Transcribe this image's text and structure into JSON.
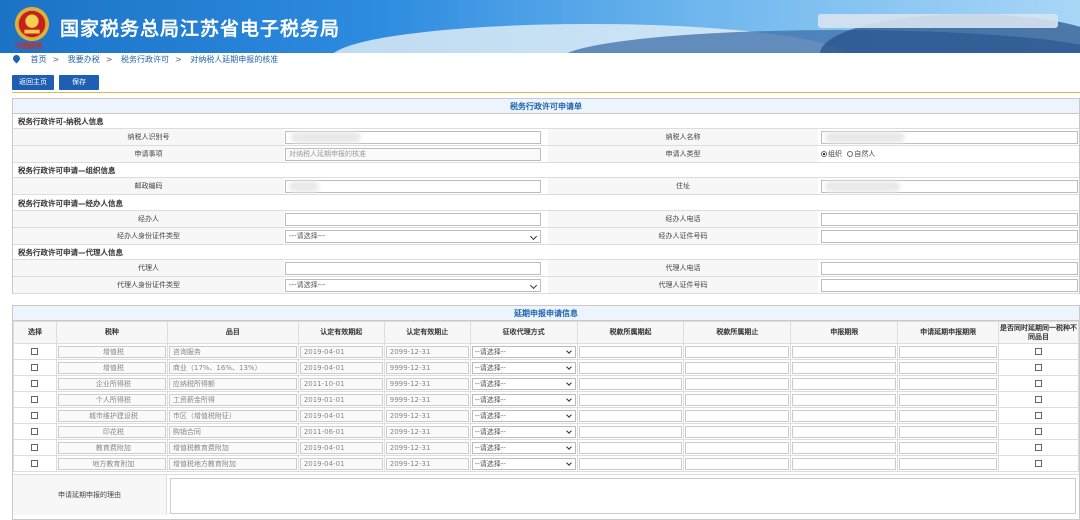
{
  "header": {
    "emblem_name": "tax-emblem",
    "emblem_caption": "中国税务",
    "site_title": "国家税务总局江苏省电子税务局"
  },
  "breadcrumb": [
    "首页",
    "我要办税",
    "税务行政许可",
    "对纳税人延期申报的核准"
  ],
  "toolbar": {
    "back_label": "返回主页",
    "save_label": "保存"
  },
  "form": {
    "title": "税务行政许可申请单",
    "sec_taxpayer": "税务行政许可-纳税人信息",
    "taxpayer_id_label": "纳税人识别号",
    "taxpayer_name_label": "纳税人名称",
    "matter_label": "申请事项",
    "matter_value": "对纳税人延期申报的核准",
    "applicant_type_label": "申请人类型",
    "applicant_type_options": [
      "组织",
      "自然人"
    ],
    "sec_org": "税务行政许可申请—组织信息",
    "postcode_label": "邮政编码",
    "address_label": "住址",
    "sec_agent": "税务行政许可申请—经办人信息",
    "agent_label": "经办人",
    "agent_phone_label": "经办人电话",
    "agent_idtype_label": "经办人身份证件类型",
    "agent_idno_label": "经办人证件号码",
    "select_placeholder": "---请选择---",
    "sec_proxy": "税务行政许可申请—代理人信息",
    "proxy_label": "代理人",
    "proxy_phone_label": "代理人电话",
    "proxy_idtype_label": "代理人身份证件类型",
    "proxy_idno_label": "代理人证件号码"
  },
  "delay": {
    "title": "延期申报申请信息",
    "headers": [
      "选择",
      "税种",
      "品目",
      "认定有效期起",
      "认定有效期止",
      "征收代理方式",
      "税款所属期起",
      "税款所属期止",
      "申报期限",
      "申请延期申报期限",
      "是否同时延期同一税种不同品目"
    ],
    "select_placeholder": "--请选择--",
    "rows": [
      {
        "tax": "增值税",
        "item": "咨询服务",
        "start": "2019-04-01",
        "end": "2099-12-31"
      },
      {
        "tax": "增值税",
        "item": "商业（17%、16%、13%）",
        "start": "2019-04-01",
        "end": "9999-12-31"
      },
      {
        "tax": "企业所得税",
        "item": "应纳税所得额",
        "start": "2011-10-01",
        "end": "9999-12-31"
      },
      {
        "tax": "个人所得税",
        "item": "工资薪金所得",
        "start": "2019-01-01",
        "end": "9999-12-31"
      },
      {
        "tax": "城市维护建设税",
        "item": "市区（增值税附征）",
        "start": "2019-04-01",
        "end": "2099-12-31"
      },
      {
        "tax": "印花税",
        "item": "购销合同",
        "start": "2011-06-01",
        "end": "2099-12-31"
      },
      {
        "tax": "教育费附加",
        "item": "增值税教育费附加",
        "start": "2019-04-01",
        "end": "2099-12-31"
      },
      {
        "tax": "地方教育附加",
        "item": "增值税地方教育附加",
        "start": "2019-04-01",
        "end": "2099-12-31"
      }
    ],
    "reason_label": "申请延期申报的理由"
  }
}
